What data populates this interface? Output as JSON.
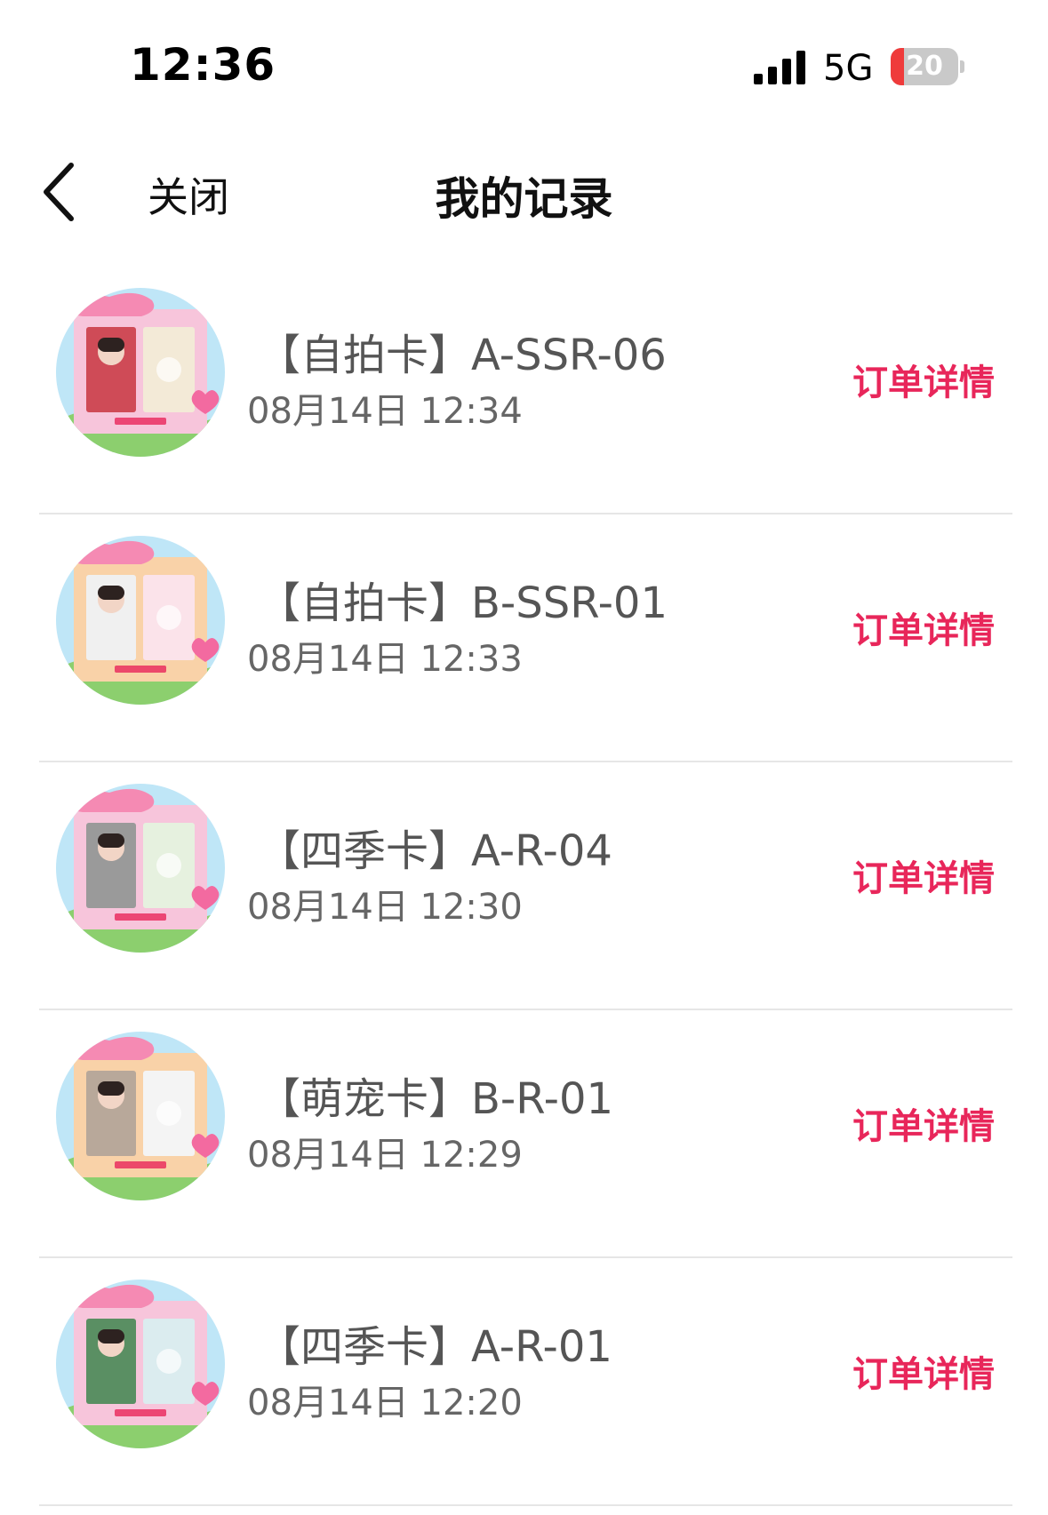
{
  "status_bar": {
    "time": "12:36",
    "network": "5G",
    "battery": "20",
    "battery_level": 0.2,
    "battery_charging": true
  },
  "nav": {
    "back_icon": "chevron-left-icon",
    "close_label": "关闭",
    "title": "我的记录"
  },
  "records": [
    {
      "title": "【自拍卡】A-SSR-06",
      "time": "08月14日 12:34",
      "action_label": "订单详情",
      "frame_color": "#f7c5db",
      "photo_color": "#cf4b57",
      "card_color": "#f3ead7"
    },
    {
      "title": "【自拍卡】B-SSR-01",
      "time": "08月14日 12:33",
      "action_label": "订单详情",
      "frame_color": "#f9d2a8",
      "photo_color": "#f0f0f0",
      "card_color": "#fbe3ea"
    },
    {
      "title": "【四季卡】A-R-04",
      "time": "08月14日 12:30",
      "action_label": "订单详情",
      "frame_color": "#f7c5db",
      "photo_color": "#9a9a9a",
      "card_color": "#e6f1df"
    },
    {
      "title": "【萌宠卡】B-R-01",
      "time": "08月14日 12:29",
      "action_label": "订单详情",
      "frame_color": "#f9d2a8",
      "photo_color": "#b8a89a",
      "card_color": "#f4f4f4"
    },
    {
      "title": "【四季卡】A-R-01",
      "time": "08月14日 12:20",
      "action_label": "订单详情",
      "frame_color": "#f7c5db",
      "photo_color": "#5a8f63",
      "card_color": "#dbecef"
    }
  ],
  "colors": {
    "accent": "#e8265a",
    "divider": "#e6e6e6",
    "battery_low": "#ef3b3b"
  }
}
